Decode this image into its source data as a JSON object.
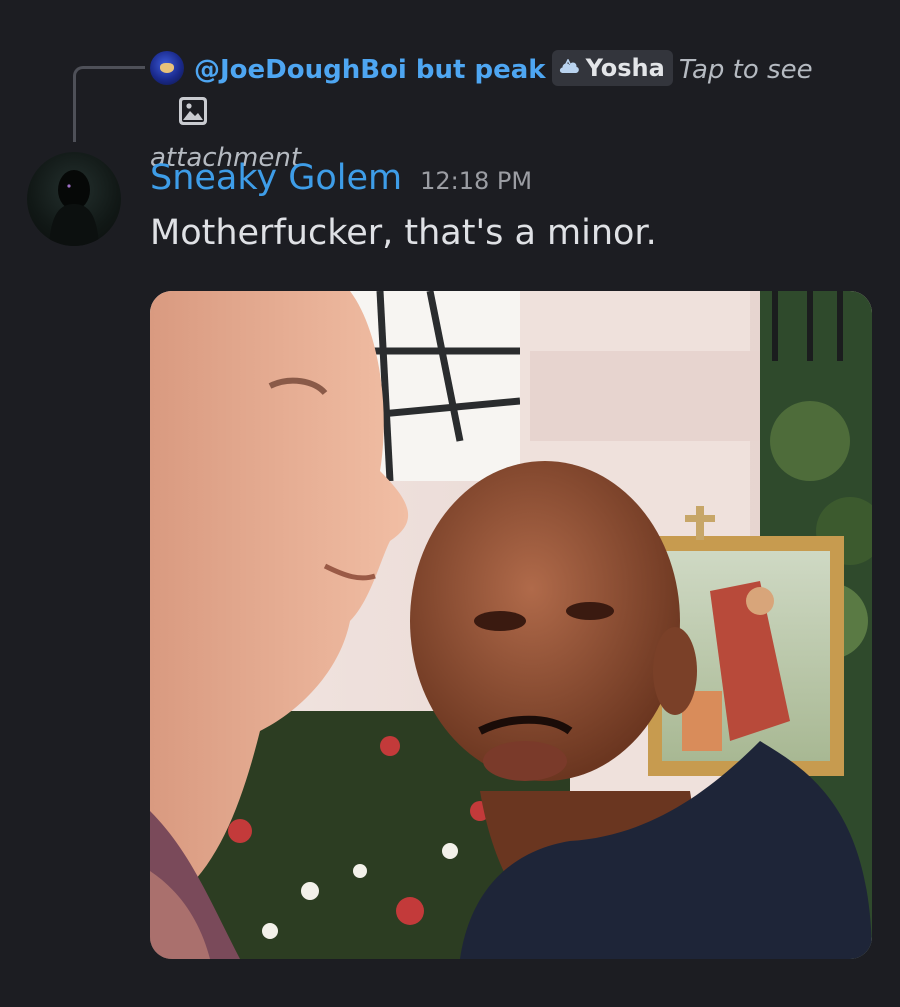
{
  "reply": {
    "author": "@JoeDoughBoi but peak",
    "mention": "Yosha",
    "preview_line1": "Tap to see",
    "preview_line2": "attachment",
    "avatar_icon": "sonic-avatar-icon",
    "mention_icon": "cloud-icon",
    "attachment_icon": "image-icon"
  },
  "message": {
    "author": "Sneaky Golem",
    "timestamp": "12:18 PM",
    "text": "Motherfucker, that's a minor.",
    "avatar_icon": "hooded-figure-avatar"
  },
  "attachment": {
    "type": "image",
    "description_icon": "photo-attachment"
  },
  "colors": {
    "background": "#1c1d22",
    "author_blue": "#3e9de8",
    "mention_bg": "#33353c",
    "timestamp_gray": "#9b9da3",
    "text_light": "#dfe1e5"
  }
}
